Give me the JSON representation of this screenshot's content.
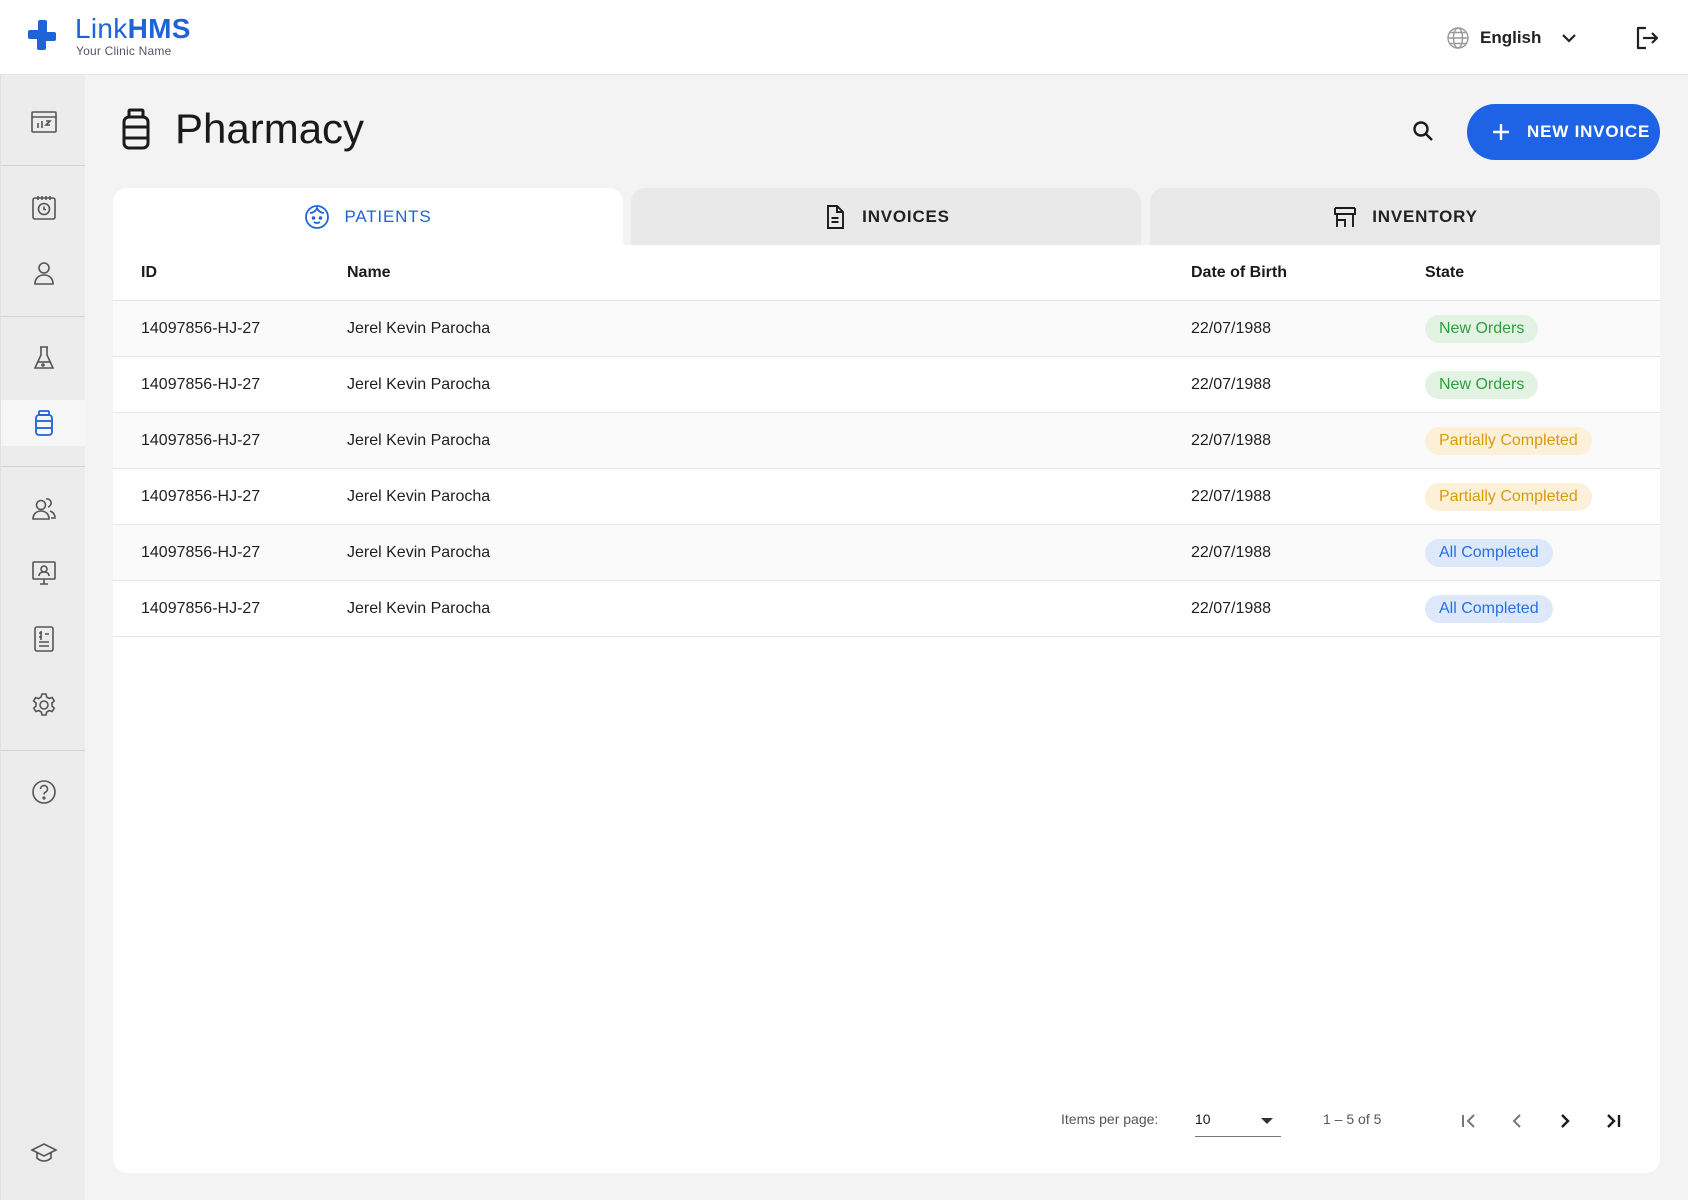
{
  "header": {
    "brand_light": "Link",
    "brand_bold": "HMS",
    "clinic_name": "Your Clinic Name",
    "language": "English"
  },
  "sidebar": {
    "items": [
      {
        "icon": "dashboard-icon"
      },
      {
        "icon": "appointments-icon"
      },
      {
        "icon": "patient-icon"
      },
      {
        "icon": "lab-icon"
      },
      {
        "icon": "pharmacy-icon",
        "active": true
      },
      {
        "icon": "staff-icon"
      },
      {
        "icon": "telemedicine-icon"
      },
      {
        "icon": "billing-icon"
      },
      {
        "icon": "settings-icon"
      },
      {
        "icon": "help-icon"
      },
      {
        "icon": "training-icon"
      }
    ]
  },
  "page": {
    "title": "Pharmacy",
    "new_invoice_label": "NEW INVOICE"
  },
  "tabs": [
    {
      "label": "PATIENTS",
      "active": true
    },
    {
      "label": "INVOICES",
      "active": false
    },
    {
      "label": "INVENTORY",
      "active": false
    }
  ],
  "table": {
    "columns": [
      "ID",
      "Name",
      "Date of Birth",
      "State"
    ],
    "rows": [
      {
        "id": "14097856-HJ-27",
        "name": "Jerel Kevin Parocha",
        "dob": "22/07/1988",
        "state": "New Orders"
      },
      {
        "id": "14097856-HJ-27",
        "name": "Jerel Kevin Parocha",
        "dob": "22/07/1988",
        "state": "New Orders"
      },
      {
        "id": "14097856-HJ-27",
        "name": "Jerel Kevin Parocha",
        "dob": "22/07/1988",
        "state": "Partially Completed"
      },
      {
        "id": "14097856-HJ-27",
        "name": "Jerel Kevin Parocha",
        "dob": "22/07/1988",
        "state": "Partially Completed"
      },
      {
        "id": "14097856-HJ-27",
        "name": "Jerel Kevin Parocha",
        "dob": "22/07/1988",
        "state": "All Completed"
      },
      {
        "id": "14097856-HJ-27",
        "name": "Jerel Kevin Parocha",
        "dob": "22/07/1988",
        "state": "All Completed"
      }
    ]
  },
  "paginator": {
    "items_per_page_label": "Items per page:",
    "items_per_page": "10",
    "range": "1 – 5 of 5"
  },
  "colors": {
    "accent": "#1e63e6",
    "new_orders_text": "#2e9e3f",
    "new_orders_bg": "#e2f3e4",
    "partial_text": "#d99a10",
    "partial_bg": "#fcf1d8",
    "complete_text": "#2a6fe0",
    "complete_bg": "#dde8fb"
  }
}
